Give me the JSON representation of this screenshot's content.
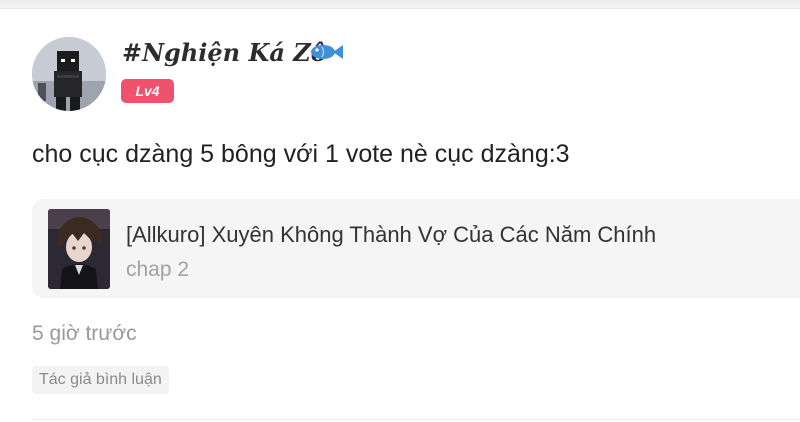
{
  "comment": {
    "username": "#Nghiện Ká Zô",
    "user_icon": "fish-icon",
    "level_badge": "Lv4",
    "text": "cho cục dzàng 5 bông với 1 vote nè cục dzàng:3",
    "timestamp": "5 giờ trước",
    "author_tag": "Tác giả bình luận"
  },
  "story": {
    "title": "[Allkuro] Xuyên Không Thành Vợ Của Các Năm Chính",
    "chapter": "chap 2"
  },
  "colors": {
    "badge_bg": "#f0516c",
    "fish": "#3f8fd9",
    "card_bg": "#f5f5f5"
  }
}
